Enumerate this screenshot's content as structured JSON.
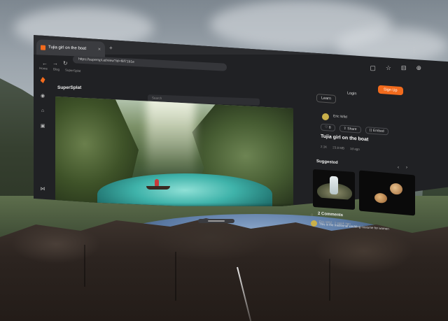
{
  "browser": {
    "tab_title": "Tujia girl on the boat",
    "tab_close": "×",
    "new_tab": "+",
    "url": "https://superspl.at/view?id=f6f71b1e",
    "bookmarks": [
      "Home",
      "Blog",
      "SuperSplat"
    ],
    "nav": {
      "back": "←",
      "forward": "→",
      "reload": "↻"
    },
    "toolbar_icons": [
      "▢",
      "☆",
      "⊟",
      "⊕"
    ],
    "menu": "⋮"
  },
  "rail": {
    "items": [
      "◉",
      "⌂",
      "▣",
      "⋈",
      "⚙",
      "◎",
      "▤",
      "⌘"
    ]
  },
  "site": {
    "brand": "SuperSplat",
    "search_placeholder": "Search",
    "learn": "Learn",
    "login": "Login",
    "signup": "Sign Up"
  },
  "video": {
    "progress": 0.12,
    "play_icon": "▶",
    "control_icons": [
      "◼",
      "⚲",
      "▷",
      "⛶",
      "⊡",
      "⤢"
    ]
  },
  "details": {
    "author": "Eric Wild",
    "actions": [
      "♡ 8",
      "⇪ Share",
      "⟨⟩ Embed"
    ],
    "title": "Tujia girl on the boat",
    "stats": [
      "2.1K",
      "23.8 MB",
      "1d ago"
    ]
  },
  "suggested": {
    "heading": "Suggested",
    "prev": "‹",
    "next": "›"
  },
  "comments": {
    "heading": "2 Comments",
    "icon": "◌",
    "author": "Eric Wild · 1 week ago",
    "text": "This is the traditional wedding costume for women"
  }
}
